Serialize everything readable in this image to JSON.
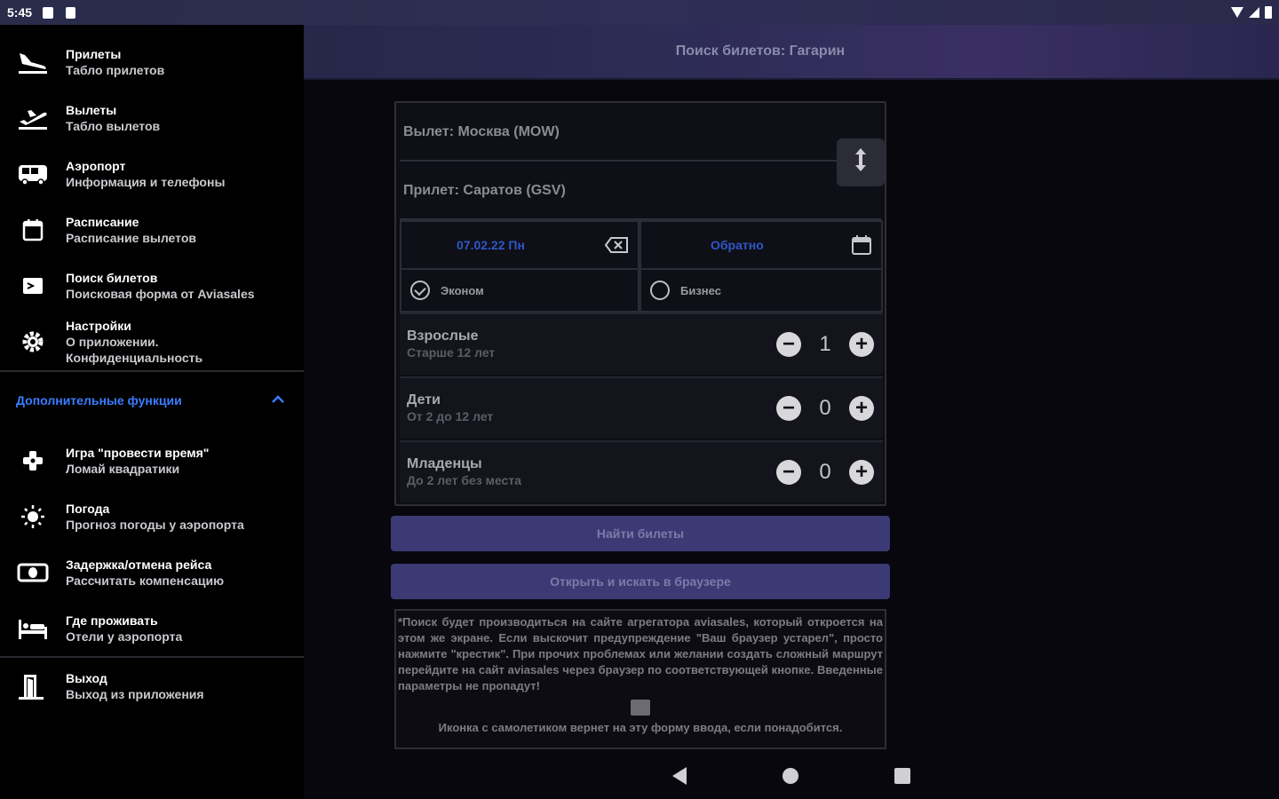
{
  "status": {
    "time": "5:45"
  },
  "header": {
    "title": "Поиск билетов: Гагарин"
  },
  "sidebar": {
    "items": [
      {
        "title": "Прилеты",
        "subtitle": "Табло прилетов",
        "icon": "flight-land-icon"
      },
      {
        "title": "Вылеты",
        "subtitle": "Табло вылетов",
        "icon": "flight-takeoff-icon"
      },
      {
        "title": "Аэропорт",
        "subtitle": "Информация и телефоны",
        "icon": "bus-icon"
      },
      {
        "title": "Расписание",
        "subtitle": "Расписание вылетов",
        "icon": "calendar-icon"
      },
      {
        "title": "Поиск билетов",
        "subtitle": "Поисковая форма от Aviasales",
        "icon": "ticket-search-icon"
      },
      {
        "title": "Настройки",
        "subtitle": "О приложении. Конфиденциальность",
        "icon": "gear-icon"
      }
    ],
    "section_label": "Дополнительные функции",
    "extra_items": [
      {
        "title": "Игра \"провести время\"",
        "subtitle": "Ломай квадратики",
        "icon": "gamepad-icon"
      },
      {
        "title": "Погода",
        "subtitle": "Прогноз погоды у аэропорта",
        "icon": "sun-icon"
      },
      {
        "title": "Задержка/отмена рейса",
        "subtitle": "Рассчитать компенсацию",
        "icon": "cash-icon"
      },
      {
        "title": "Где проживать",
        "subtitle": "Отели у аэропорта",
        "icon": "bed-icon"
      }
    ],
    "exit": {
      "title": "Выход",
      "subtitle": "Выход из приложения",
      "icon": "exit-door-icon"
    }
  },
  "form": {
    "departure": "Вылет: Москва (MOW)",
    "arrival": "Прилет: Саратов (GSV)",
    "date_there": "07.02.22 Пн",
    "date_back": "Обратно",
    "class_economy": "Эконом",
    "class_business": "Бизнес",
    "selected_class": "economy",
    "passengers": [
      {
        "label": "Взрослые",
        "hint": "Старше 12 лет",
        "count": "1"
      },
      {
        "label": "Дети",
        "hint": "От 2 до 12 лет",
        "count": "0"
      },
      {
        "label": "Младенцы",
        "hint": "До 2 лет без места",
        "count": "0"
      }
    ],
    "find_button": "Найти билеты",
    "browser_button": "Открыть и искать в браузере"
  },
  "note": {
    "text": "*Поиск будет производиться на сайте агрегатора aviasales, который откроется на этом же экране. Если выскочит предупреждение \"Ваш браузер устарел\", просто нажмите \"крестик\". При прочих проблемах или желании создать сложный маршрут перейдите на сайт aviasales через браузер по соответствующей кнопке. Введенные параметры не пропадут!",
    "footer": "Иконка с самолетиком вернет на эту форму ввода, если понадобится."
  },
  "colors": {
    "accent": "#3b7cff",
    "button": "#3b3a75",
    "background": "#07070d"
  }
}
